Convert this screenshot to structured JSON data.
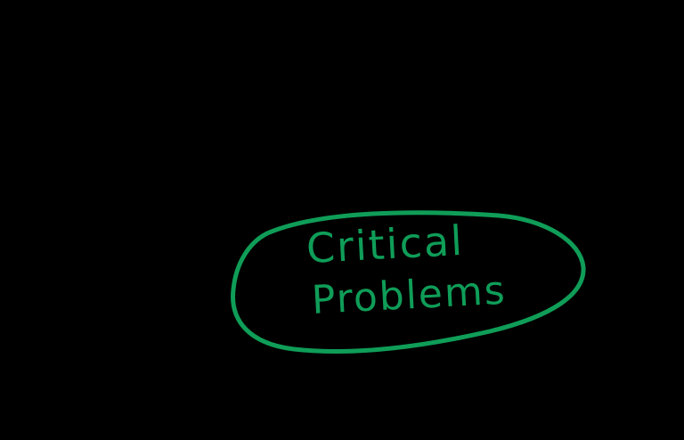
{
  "stroke_color": "#0f9d58",
  "background_color": "#000000",
  "ellipse": {
    "line1": "Critical",
    "line2": "Problems"
  }
}
